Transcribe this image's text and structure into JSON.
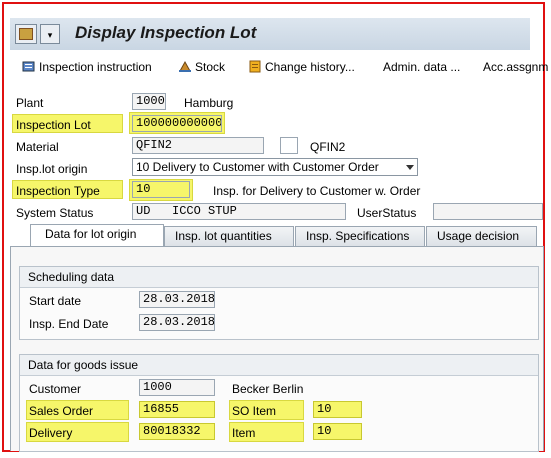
{
  "window": {
    "title": "Display Inspection Lot"
  },
  "toolbar": {
    "inspection_instruction": "Inspection instruction",
    "stock": "Stock",
    "change_history": "Change history...",
    "admin_data": "Admin. data ...",
    "acc_assignment": "Acc.assgnm"
  },
  "header": {
    "plant_label": "Plant",
    "plant_value": "1000",
    "plant_name": "Hamburg",
    "inspection_lot_label": "Inspection Lot",
    "inspection_lot_value": "100000000000",
    "material_label": "Material",
    "material_value": "QFIN2",
    "material_desc": "QFIN2",
    "insp_lot_origin_label": "Insp.lot origin",
    "insp_lot_origin_value": "10 Delivery to Customer with Customer Order",
    "inspection_type_label": "Inspection Type",
    "inspection_type_value": "10",
    "inspection_type_desc": "Insp. for Delivery to Customer w. Order",
    "system_status_label": "System Status",
    "system_status_value": "UD   ICCO STUP",
    "user_status_label": "UserStatus",
    "user_status_value": ""
  },
  "tabs": [
    {
      "label": "Data for lot origin",
      "active": true
    },
    {
      "label": "Insp. lot quantities",
      "active": false
    },
    {
      "label": "Insp. Specifications",
      "active": false
    },
    {
      "label": "Usage decision",
      "active": false
    }
  ],
  "scheduling": {
    "title": "Scheduling data",
    "start_date_label": "Start date",
    "start_date_value": "28.03.2018",
    "end_date_label": "Insp. End Date",
    "end_date_value": "28.03.2018"
  },
  "goods_issue": {
    "title": "Data for goods issue",
    "customer_label": "Customer",
    "customer_value": "1000",
    "customer_name": "Becker Berlin",
    "sales_order_label": "Sales Order",
    "sales_order_value": "16855",
    "so_item_label": "SO Item",
    "so_item_value": "10",
    "delivery_label": "Delivery",
    "delivery_value": "80018332",
    "item_label": "Item",
    "item_value": "10"
  },
  "colors": {
    "highlight": "#f6f66a",
    "frame_border": "#e01010"
  }
}
